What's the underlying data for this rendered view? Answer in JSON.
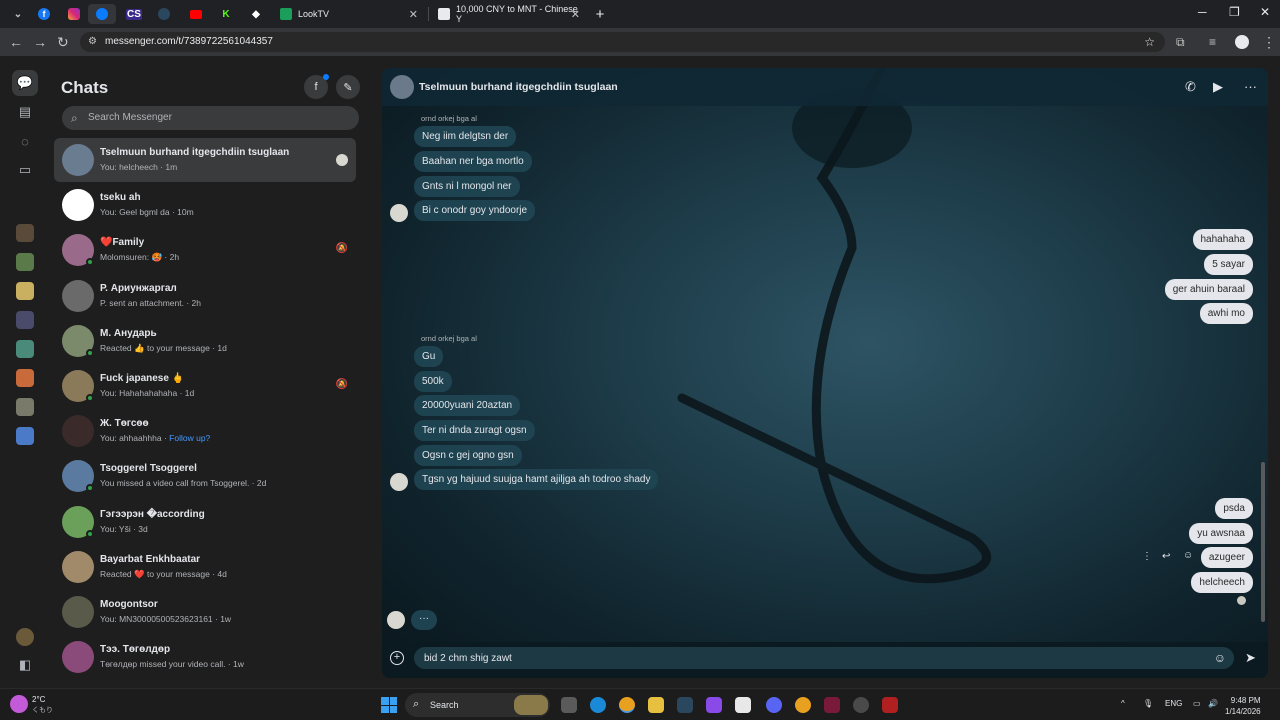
{
  "browser": {
    "tabs": [
      {
        "title": "LookTV"
      },
      {
        "title": "10,000 CNY to MNT - Chinese Y"
      }
    ],
    "new_tab": "+",
    "url": "messenger.com/t/7389722561044357"
  },
  "sidebar": {
    "title": "Chats",
    "search_placeholder": "Search Messenger",
    "chats": [
      {
        "name": "Tselmuun burhand itgegchdiin tsuglaan",
        "sub": "You: helcheech · 1m",
        "color": "#6a7c90",
        "selected": true,
        "online": false
      },
      {
        "name": "tseku ah",
        "sub": "You: Geel bgml da · 10m",
        "color": "#ffffff",
        "selected": false,
        "online": false
      },
      {
        "name": "❤️Family",
        "sub": "Molomsuren: 🥵 · 2h",
        "color": "#9a6a8a",
        "selected": false,
        "online": true,
        "muted": true
      },
      {
        "name": "Р. Ариунжаргал",
        "sub": "P. sent an attachment. · 2h",
        "color": "#6a6a6a",
        "selected": false,
        "online": false
      },
      {
        "name": "М. Анударь",
        "sub": "Reacted 👍 to your message · 1d",
        "color": "#7a8a6a",
        "selected": false,
        "online": true
      },
      {
        "name": "Fuck japanese 🖕",
        "sub": "You: Hahahahahaha · 1d",
        "color": "#8a7a5a",
        "selected": false,
        "online": true,
        "muted": true
      },
      {
        "name": "Ж. Төгсөө",
        "sub": "You: ahhaahhha · ",
        "sub_link": "Follow up?",
        "color": "#3a2a2a",
        "selected": false,
        "online": false
      },
      {
        "name": "Tsoggerel Tsoggerel",
        "sub": "You missed a video call from Tsoggerel. · 2d",
        "color": "#5a7aa0",
        "selected": false,
        "online": true
      },
      {
        "name": "Гэгээрэн �according",
        "sub": "You: Yši · 3d",
        "color": "#6aa05a",
        "selected": false,
        "online": true
      },
      {
        "name": "Bayarbat Enkhbaatar",
        "sub": "Reacted ❤️ to your message · 4d",
        "color": "#a08a6a",
        "selected": false,
        "online": false
      },
      {
        "name": "Moogontsor",
        "sub": "You: MN30000500523623161 · 1w",
        "color": "#5a5a4a",
        "selected": false,
        "online": false
      },
      {
        "name": "Тээ. Төгөлдөр",
        "sub": "Төгөлдөр missed your video call. · 1w",
        "color": "#8a4a7a",
        "selected": false,
        "online": false
      }
    ]
  },
  "conversation": {
    "title": "Tselmuun burhand itgegchdiin tsuglaan",
    "groups": [
      {
        "sender": "ornd orkej bga al",
        "messages": [
          "Neg iim delgtsn der",
          "Baahan ner bga mortlo",
          "Gnts ni l mongol ner",
          "Bi c onodr goy yndoorje"
        ]
      },
      {
        "sender": "",
        "outgoing": [
          "hahahaha",
          "5 sayar",
          "ger ahuin baraal",
          "awhi mo"
        ]
      },
      {
        "sender": "ornd orkej bga al",
        "messages": [
          "Gu",
          "500k",
          "20000yuani 20aztan",
          "Ter ni dnda zuragt ogsn",
          "Ogsn c gej ogno gsn",
          "Tgsn yg hajuud suujga hamt ajiljga ah todroo shady"
        ]
      },
      {
        "sender": "",
        "outgoing": [
          "psda",
          "yu awsnaa",
          "azugeer",
          "helcheech"
        ]
      }
    ],
    "typing_indicator": "···",
    "composer_text": "bid  2 chm shig zawt"
  },
  "taskbar": {
    "temp": "2°C",
    "condition": "くもり",
    "search": "Search",
    "lang": "ENG",
    "time": "9:48 PM",
    "date": "1/14/2026"
  }
}
